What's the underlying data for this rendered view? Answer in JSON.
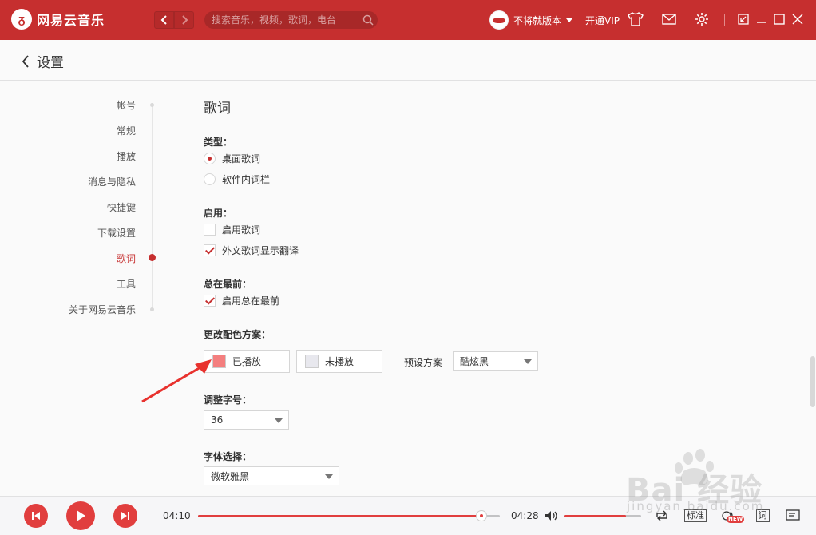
{
  "app": {
    "name": "网易云音乐"
  },
  "topbar": {
    "search_placeholder": "搜索音乐，视频，歌词，电台",
    "username": "不将就版本",
    "vip_label": "开通VIP",
    "icons": [
      "chevron-left-icon",
      "chevron-right-icon",
      "search-icon",
      "skin-icon",
      "mail-icon",
      "gear-icon",
      "mini-mode-icon",
      "minimize-icon",
      "maximize-icon",
      "close-icon"
    ]
  },
  "header": {
    "title": "设置"
  },
  "sidebar": {
    "items": [
      {
        "label": "帐号",
        "active": false
      },
      {
        "label": "常规",
        "active": false
      },
      {
        "label": "播放",
        "active": false
      },
      {
        "label": "消息与隐私",
        "active": false
      },
      {
        "label": "快捷键",
        "active": false
      },
      {
        "label": "下载设置",
        "active": false
      },
      {
        "label": "歌词",
        "active": true
      },
      {
        "label": "工具",
        "active": false
      },
      {
        "label": "关于网易云音乐",
        "active": false
      }
    ]
  },
  "main": {
    "section_title": "歌词",
    "type": {
      "label": "类型：",
      "options": [
        {
          "label": "桌面歌词",
          "selected": true
        },
        {
          "label": "软件内词栏",
          "selected": false
        }
      ]
    },
    "enable": {
      "label": "启用：",
      "options": [
        {
          "label": "启用歌词",
          "checked": false
        },
        {
          "label": "外文歌词显示翻译",
          "checked": true
        }
      ]
    },
    "always_on_top": {
      "label": "总在最前：",
      "options": [
        {
          "label": "启用总在最前",
          "checked": true
        }
      ]
    },
    "color_scheme": {
      "label": "更改配色方案：",
      "played_label": "已播放",
      "played_color": "#f47f7f",
      "unplayed_label": "未播放",
      "unplayed_color": "#e8e8ee",
      "preset_label": "预设方案",
      "preset_value": "酷炫黑"
    },
    "font_size": {
      "label": "调整字号：",
      "value": "36"
    },
    "font_face": {
      "label": "字体选择：",
      "value": "微软雅黑"
    }
  },
  "player": {
    "current_time": "04:10",
    "total_time": "04:28",
    "progress": 0.94,
    "volume": 0.8,
    "quality_label": "标准",
    "lyric_button": "词",
    "new_badge": "NEW"
  },
  "colors": {
    "brand": "#c62f2f",
    "accent": "#e13e3e"
  },
  "watermark": {
    "text": "Bai 经验",
    "url": "jingyan.baidu.com"
  }
}
